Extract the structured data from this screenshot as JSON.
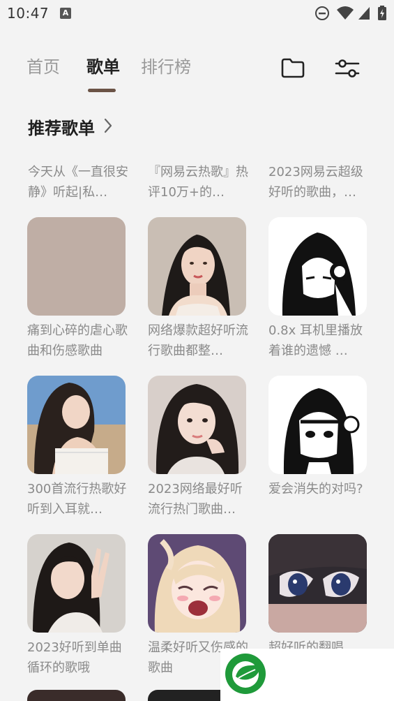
{
  "status_bar": {
    "time": "10:47",
    "notification_icon": "A"
  },
  "tabs": [
    {
      "label": "首页",
      "active": false
    },
    {
      "label": "歌单",
      "active": true
    },
    {
      "label": "排行榜",
      "active": false
    }
  ],
  "header_icons": [
    "folder-icon",
    "filter-sliders-icon"
  ],
  "section": {
    "title": "推荐歌单"
  },
  "text_playlists": [
    {
      "title": "今天从《一直很安静》听起|私…"
    },
    {
      "title": "『网易云热歌』热评10万+的…"
    },
    {
      "title": "2023网易云超级好听的歌曲，…"
    }
  ],
  "playlists": [
    {
      "title": "痛到心碎的虐心歌曲和伤感歌曲",
      "cover": "plain-mauve"
    },
    {
      "title": "网络爆款超好听流行歌曲都整…",
      "cover": "girl-portrait"
    },
    {
      "title": "0.8x 耳机里播放着谁的遗憾 …",
      "cover": "anime-bw-headphones"
    },
    {
      "title": "300首流行热歌好听到入耳就…",
      "cover": "girl-beach"
    },
    {
      "title": "2023网络最好听流行热门歌曲…",
      "cover": "girl-hand-cheek"
    },
    {
      "title": "爱会消失的对吗?",
      "cover": "anime-bw-girl"
    },
    {
      "title": "2023好听到单曲循环的歌哦",
      "cover": "girl-peace-sign"
    },
    {
      "title": "温柔好听又伤感的歌曲",
      "cover": "anime-crying-girl"
    },
    {
      "title": "超好听的翻唱",
      "cover": "anime-eyes"
    }
  ],
  "colors": {
    "background": "#f3f3f3",
    "tab_indicator": "#6b5346",
    "muted_text": "#8a8a8a",
    "ad_logo_green": "#1f9a3a"
  }
}
